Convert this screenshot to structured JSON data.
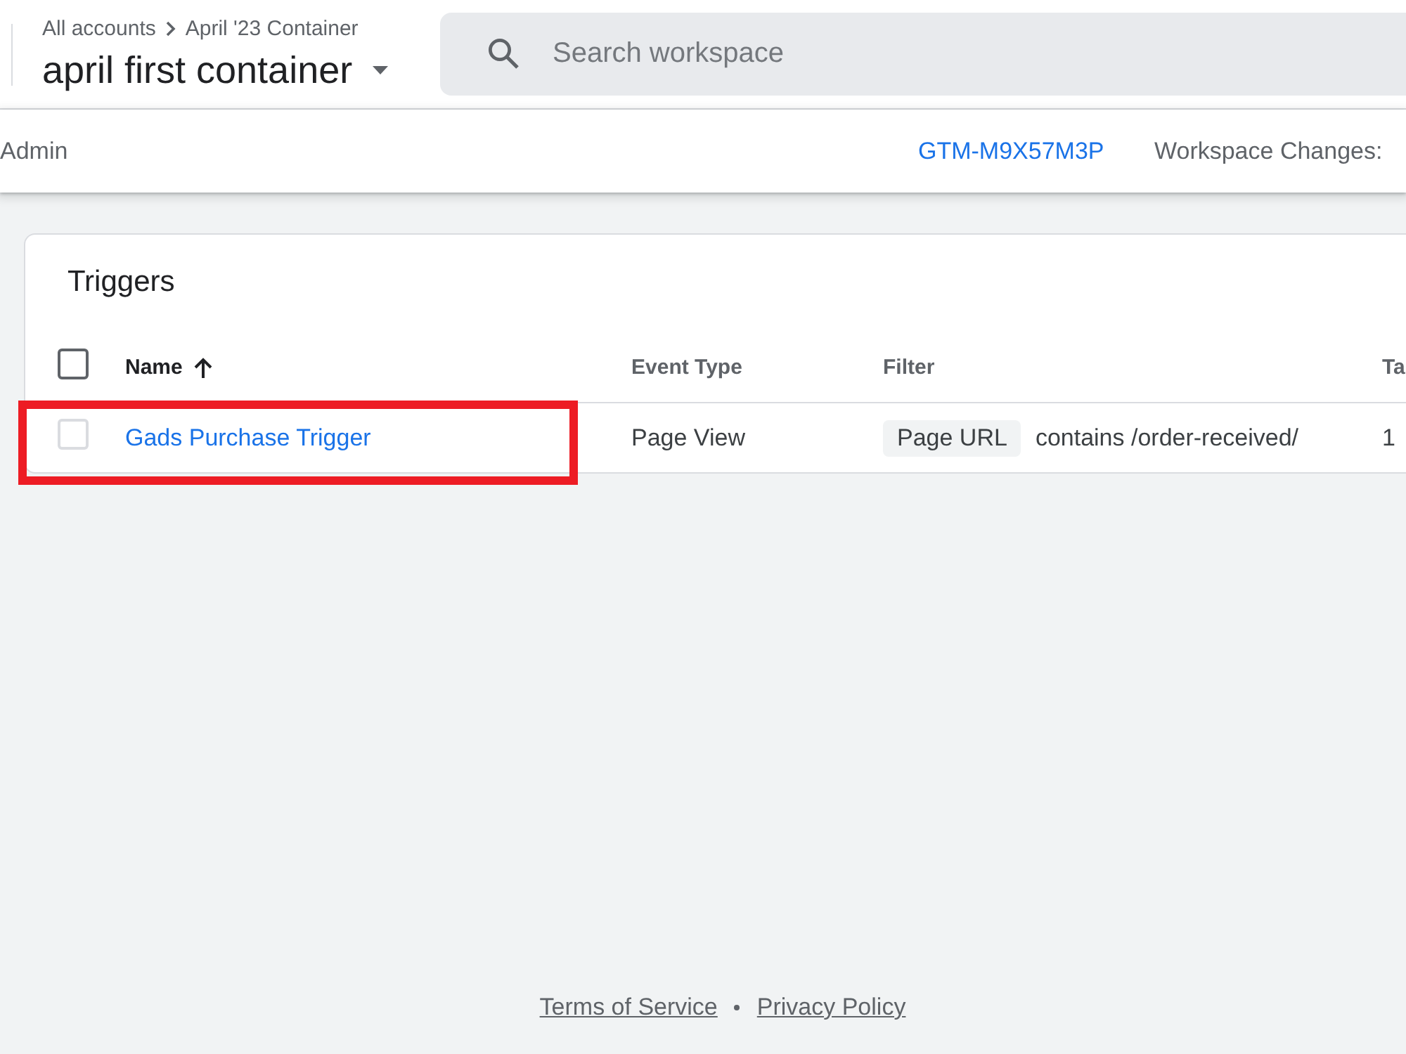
{
  "header": {
    "breadcrumb": [
      "All accounts",
      "April '23 Container"
    ],
    "title": "april first container",
    "search": {
      "placeholder": "Search workspace"
    }
  },
  "toolbar": {
    "nav_item": "Admin",
    "container_id": "GTM-M9X57M3P",
    "workspace_changes": "Workspace Changes:"
  },
  "triggers": {
    "title": "Triggers",
    "select_all": {
      "checked": false
    },
    "columns": [
      {
        "label": "Name",
        "sorted": true
      },
      {
        "label": "Event Type",
        "sorted": false
      },
      {
        "label": "Filter",
        "sorted": false
      },
      {
        "label": "Ta",
        "sorted": false
      }
    ],
    "rows": [
      {
        "checked": false,
        "highlighted": true,
        "name": "Gads Purchase Trigger",
        "event_type": "Page View",
        "filter": {
          "variable": "Page URL",
          "condition": "contains /order-received/"
        },
        "column_4": "1"
      }
    ]
  },
  "footer": {
    "links": [
      "Terms of Service",
      "Privacy Policy"
    ]
  }
}
